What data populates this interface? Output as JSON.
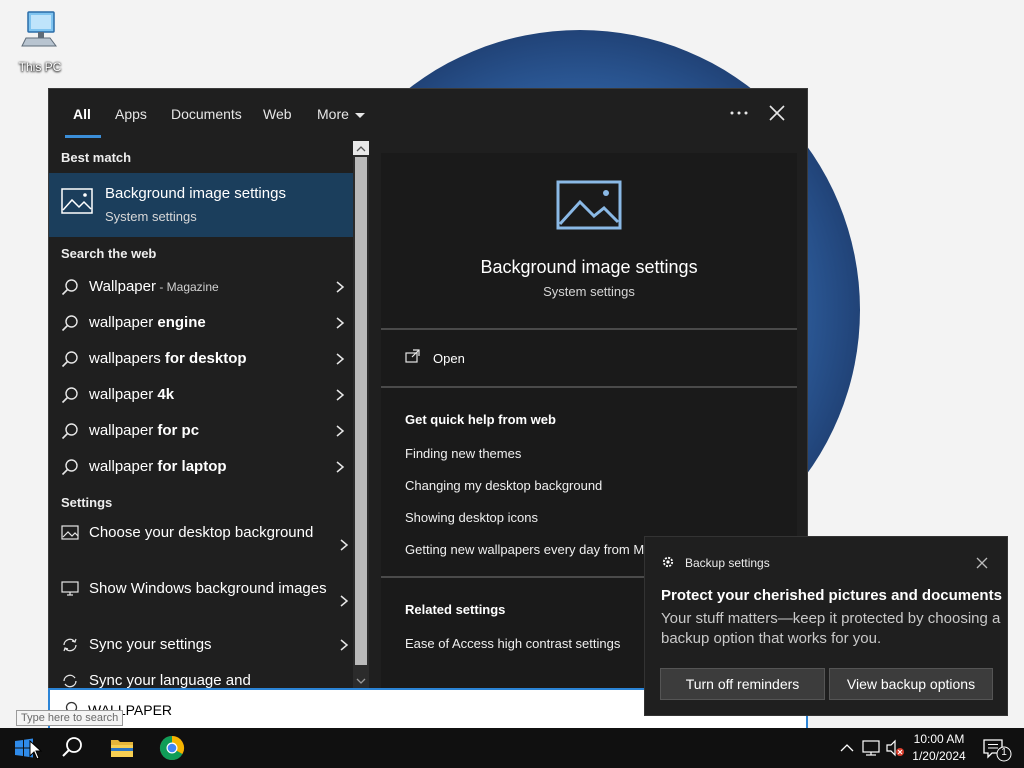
{
  "desktop": {
    "icons": [
      {
        "label": "This PC",
        "icon": "this-pc-icon"
      }
    ]
  },
  "search": {
    "tabs": [
      {
        "label": "All",
        "active": true
      },
      {
        "label": "Apps"
      },
      {
        "label": "Documents"
      },
      {
        "label": "Web"
      },
      {
        "label": "More"
      }
    ],
    "more_options_icon": "ellipsis-icon",
    "close_icon": "close-icon",
    "best_match_heading": "Best match",
    "best_match": {
      "title": "Background image settings",
      "subtitle": "System settings",
      "icon": "picture-icon"
    },
    "web_heading": "Search the web",
    "web_results": [
      {
        "prefix": "Wallpaper",
        "suffix": "",
        "sub": " - Magazine"
      },
      {
        "prefix": "wallpaper ",
        "suffix": "engine",
        "sub": ""
      },
      {
        "prefix": "wallpapers ",
        "suffix": "for desktop",
        "sub": ""
      },
      {
        "prefix": "wallpaper ",
        "suffix": "4k",
        "sub": ""
      },
      {
        "prefix": "wallpaper ",
        "suffix": "for pc",
        "sub": ""
      },
      {
        "prefix": "wallpaper ",
        "suffix": "for laptop",
        "sub": ""
      }
    ],
    "settings_heading": "Settings",
    "settings_results": [
      {
        "label": "Choose your desktop background",
        "icon": "picture-icon"
      },
      {
        "label": "Show Windows background images",
        "icon": "monitor-icon"
      },
      {
        "label": "Sync your settings",
        "icon": "sync-icon"
      },
      {
        "label": "Sync your language and",
        "icon": "sync-icon"
      }
    ],
    "preview": {
      "title": "Background image settings",
      "subtitle": "System settings",
      "open_label": "Open",
      "quick_help_heading": "Get quick help from web",
      "quick_help_links": [
        "Finding new themes",
        "Changing my desktop background",
        "Showing desktop icons",
        "Getting new wallpapers every day from M"
      ],
      "related_heading": "Related settings",
      "related_links": [
        "Ease of Access high contrast settings"
      ]
    },
    "query": "WALLPAPER",
    "placeholder_tip": "Type here to search"
  },
  "toast": {
    "app": "Backup settings",
    "heading": "Protect your cherished pictures and documents",
    "body": "Your stuff matters—keep it protected by choosing a backup option that works for you.",
    "buttons": [
      "Turn off reminders",
      "View backup options"
    ]
  },
  "taskbar": {
    "apps": [
      "start-icon",
      "search-icon",
      "file-explorer-icon",
      "chrome-icon"
    ],
    "tray": [
      "chevron-up-icon",
      "network-icon",
      "volume-muted-icon"
    ],
    "time": "10:00 AM",
    "date": "1/20/2024",
    "notification_count": "1"
  },
  "colors": {
    "accent": "#3b8ed8",
    "selection": "#1b3e5c",
    "panel": "#1f1f1f"
  }
}
